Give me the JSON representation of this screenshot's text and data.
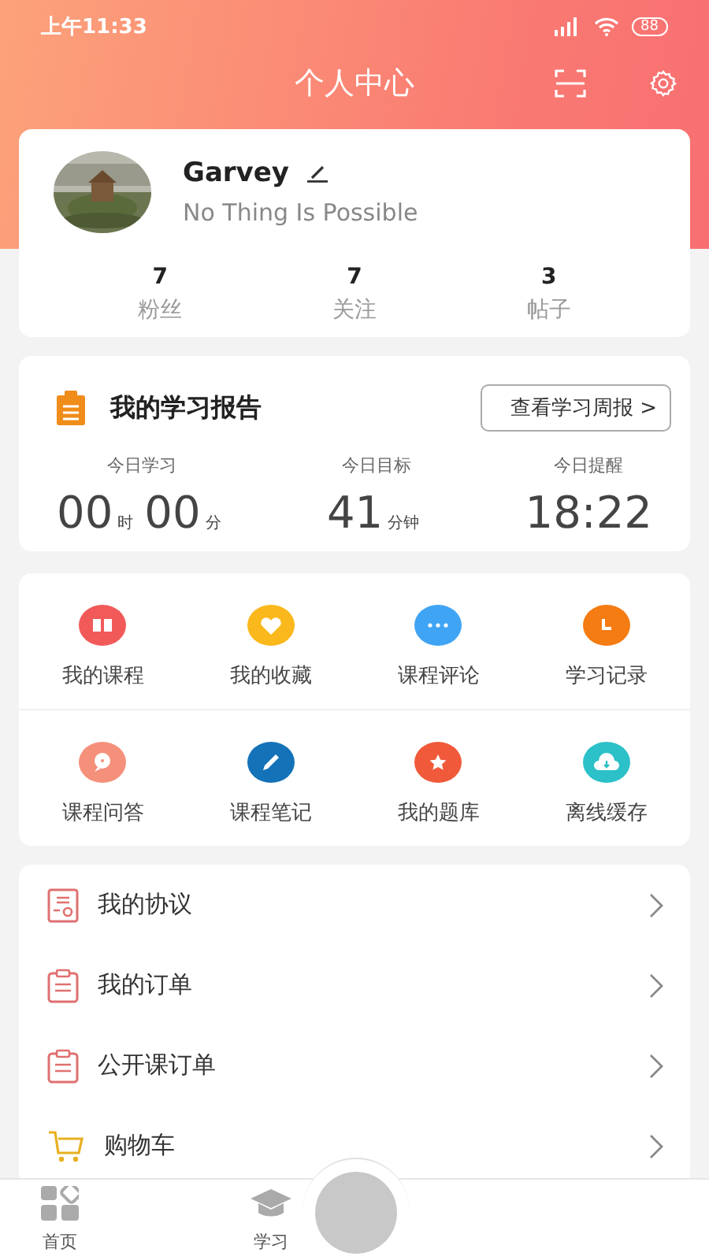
{
  "status_bar": {
    "time": "上午11:33",
    "battery": "88"
  },
  "header": {
    "title": "个人中心"
  },
  "profile": {
    "name": "Garvey",
    "motto": "No Thing Is Possible",
    "stats": [
      {
        "value": "7",
        "label": "粉丝"
      },
      {
        "value": "7",
        "label": "关注"
      },
      {
        "value": "3",
        "label": "帖子"
      }
    ]
  },
  "report": {
    "title": "我的学习报告",
    "button": "查看学习周报 >",
    "today_study": {
      "label": "今日学习",
      "hours": "00",
      "hours_unit": "时",
      "minutes": "00",
      "minutes_unit": "分"
    },
    "today_goal": {
      "label": "今日目标",
      "value": "41",
      "unit": "分钟"
    },
    "today_reminder": {
      "label": "今日提醒",
      "value": "18:22"
    }
  },
  "features": [
    {
      "label": "我的课程",
      "kind": "book",
      "color": "#f25a5a"
    },
    {
      "label": "我的收藏",
      "kind": "heart",
      "color": "#fbb81c"
    },
    {
      "label": "课程评论",
      "kind": "dots",
      "color": "#40a4f4"
    },
    {
      "label": "学习记录",
      "kind": "clock",
      "color": "#f57c12"
    },
    {
      "label": "课程问答",
      "kind": "question",
      "color": "#f5907a"
    },
    {
      "label": "课程笔记",
      "kind": "pencil",
      "color": "#1472b8"
    },
    {
      "label": "我的题库",
      "kind": "star",
      "color": "#f05a3a"
    },
    {
      "label": "离线缓存",
      "kind": "cloud",
      "color": "#2cc0c8"
    }
  ],
  "menu": [
    {
      "label": "我的协议",
      "kind": "document"
    },
    {
      "label": "我的订单",
      "kind": "clipboard"
    },
    {
      "label": "公开课订单",
      "kind": "clipboard"
    },
    {
      "label": "购物车",
      "kind": "cart"
    }
  ],
  "tab_bar": [
    {
      "label": "首页",
      "kind": "home",
      "selected": false
    },
    {
      "label": "学习",
      "kind": "cap",
      "selected": false
    }
  ]
}
